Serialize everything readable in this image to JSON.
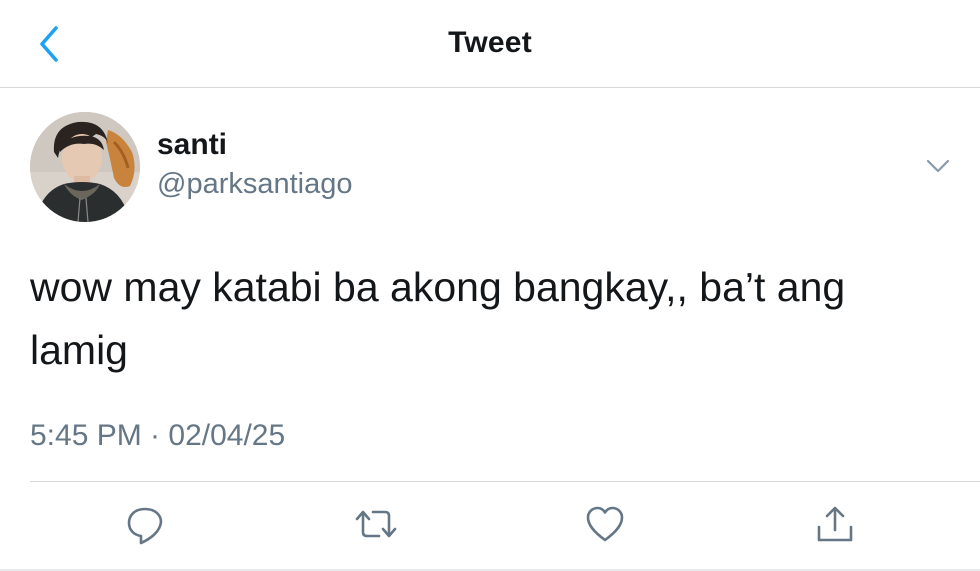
{
  "nav": {
    "title": "Tweet",
    "back_icon": "chevron-left-icon"
  },
  "author": {
    "name": "santi",
    "handle": "@parksantiago"
  },
  "tweet": {
    "text": "wow may katabi ba akong bangkay,, ba’t ang lamig",
    "timestamp": "5:45 PM · 02/04/25"
  },
  "actions": [
    {
      "icon": "reply-icon"
    },
    {
      "icon": "retweet-icon"
    },
    {
      "icon": "like-icon"
    },
    {
      "icon": "share-icon"
    }
  ],
  "colors": {
    "accent": "#1da1f2",
    "secondary_text": "#657786",
    "primary_text": "#14171a",
    "divider": "#d6d9dc"
  }
}
